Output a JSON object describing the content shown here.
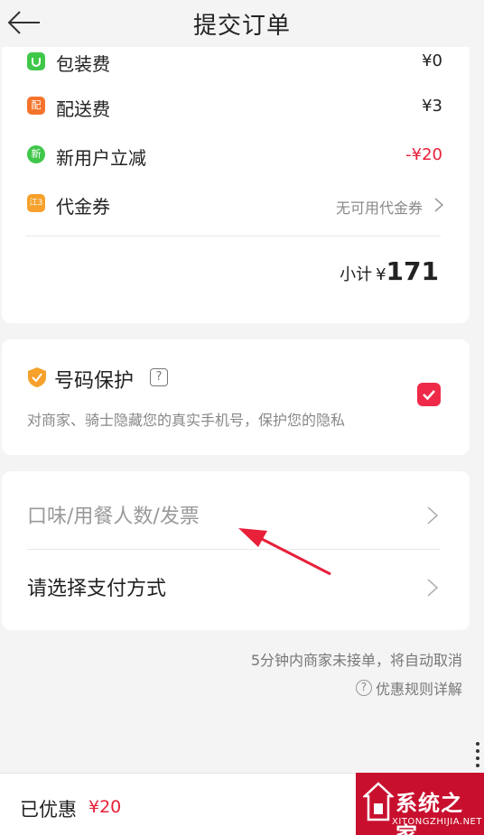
{
  "header": {
    "title": "提交订单"
  },
  "fees": {
    "packaging": {
      "label": "包装费",
      "value": "¥0"
    },
    "delivery": {
      "label": "配送费",
      "badge": "配",
      "value": "¥3"
    },
    "new_user": {
      "label": "新用户立减",
      "badge": "新",
      "value": "-¥20"
    },
    "voucher": {
      "label": "代金券",
      "badge": "江3",
      "value": "无可用代金券"
    },
    "subtotal": {
      "label": "小计",
      "currency": "¥",
      "amount": "171"
    }
  },
  "privacy": {
    "title": "号码保护",
    "help": "?",
    "description": "对商家、骑士隐藏您的真实手机号，保护您的隐私",
    "checked": true
  },
  "options": {
    "taste": "口味/用餐人数/发票",
    "payment": "请选择支付方式"
  },
  "notes": {
    "auto_cancel": "5分钟内商家未接单，将自动取消",
    "rules_help": "?",
    "rules": "优惠规则详解"
  },
  "footer": {
    "label": "已优惠",
    "amount": "¥20"
  },
  "watermark": {
    "text": "系统之家",
    "sub": "XITONGZHIJIA.NET"
  },
  "colors": {
    "accent_red": "#e8203a",
    "delivery_badge": "#f5732b",
    "new_user_badge": "#3fc74a",
    "voucher_badge": "#f5a12b",
    "packaging_badge": "#3fc74a",
    "shield": "#f5a12b"
  }
}
